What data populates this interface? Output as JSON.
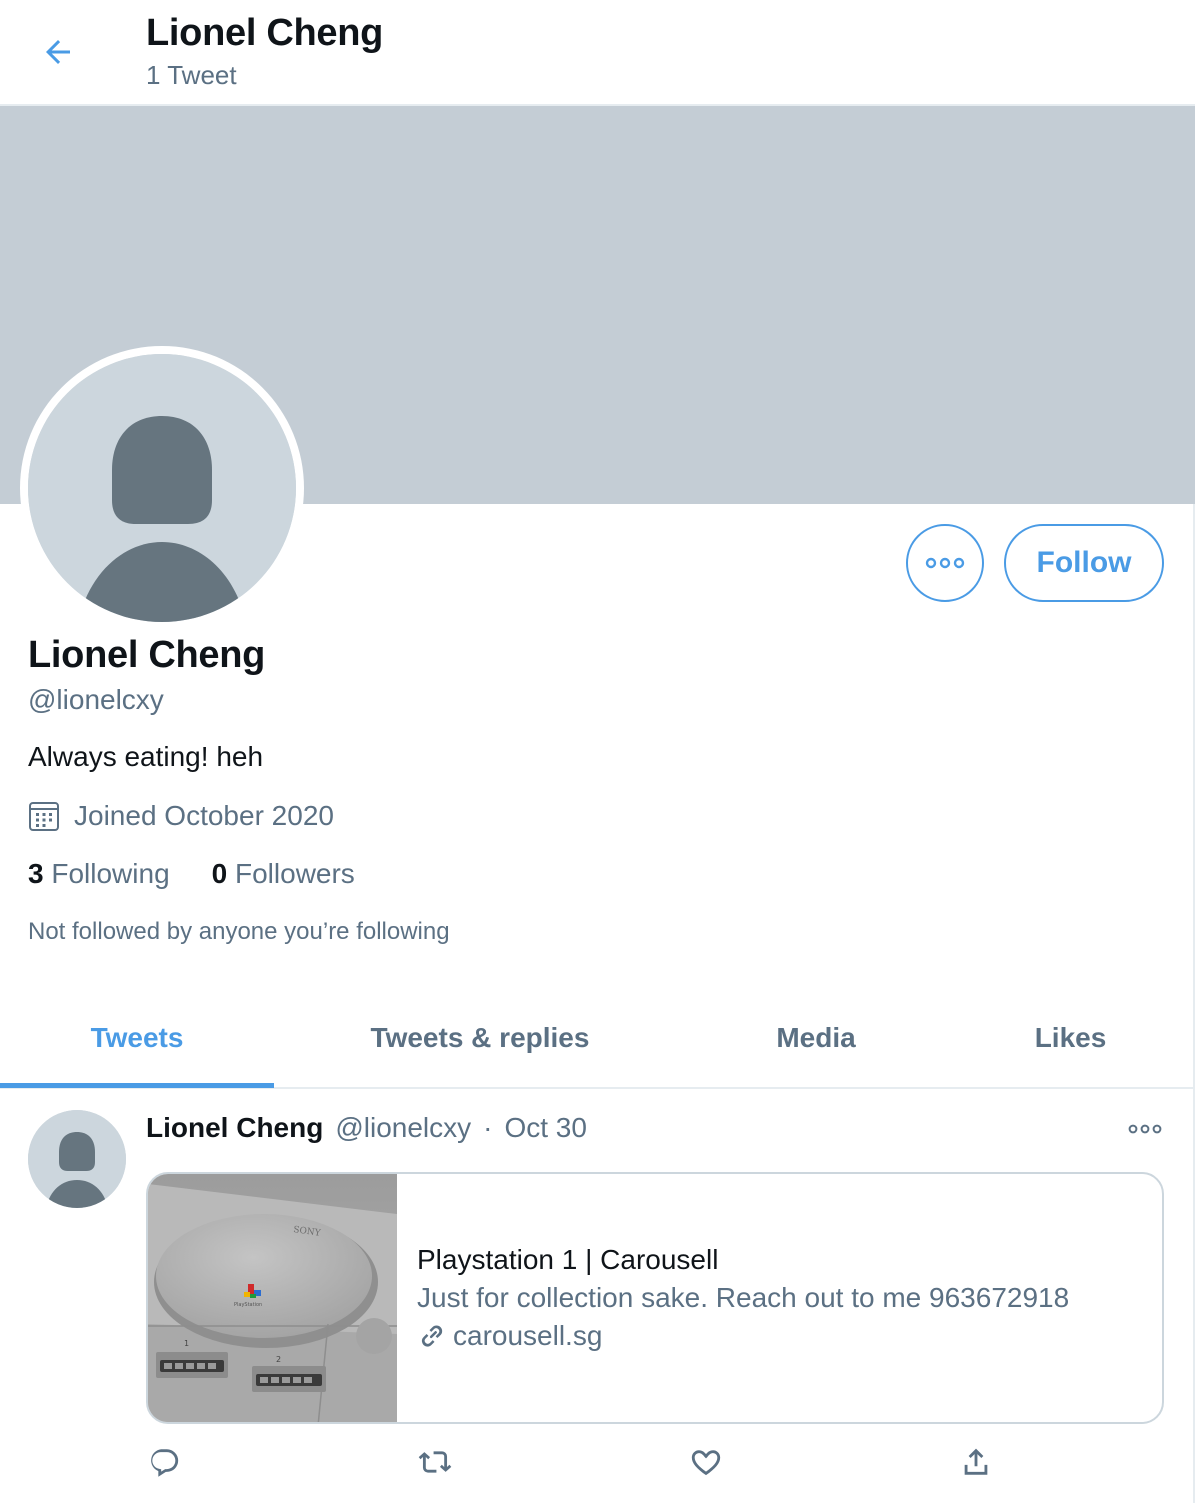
{
  "header": {
    "title": "Lionel Cheng",
    "tweet_count": "1 Tweet"
  },
  "profile": {
    "name": "Lionel Cheng",
    "handle": "@lionelcxy",
    "bio": "Always eating! heh",
    "joined": "Joined October 2020",
    "following_count": "3",
    "following_label": "Following",
    "followers_count": "0",
    "followers_label": "Followers",
    "mutual_note": "Not followed by anyone you’re following",
    "follow_label": "Follow"
  },
  "tabs": [
    {
      "label": "Tweets",
      "active": true
    },
    {
      "label": "Tweets & replies",
      "active": false
    },
    {
      "label": "Media",
      "active": false
    },
    {
      "label": "Likes",
      "active": false
    }
  ],
  "tweet": {
    "name": "Lionel Cheng",
    "handle": "@lionelcxy",
    "separator": "·",
    "date": "Oct 30",
    "card": {
      "title": "Playstation 1 | Carousell",
      "description": "Just for collection sake. Reach out to me 963672918",
      "domain": "carousell.sg",
      "image_brand": "SONY",
      "image_logo_text": "PlayStation",
      "port_1": "1",
      "port_2": "2"
    }
  },
  "colors": {
    "accent": "#4a9be5",
    "banner": "#c4cdd5",
    "secondary_text": "#5b7083",
    "avatar_bg": "#ccd6dd",
    "avatar_silhouette": "#66757f"
  },
  "icons": {
    "back": "arrow-left-icon",
    "more": "more-dots-icon",
    "calendar": "calendar-icon",
    "link": "link-icon",
    "reply": "reply-icon",
    "retweet": "retweet-icon",
    "like": "heart-icon",
    "share": "share-icon"
  }
}
